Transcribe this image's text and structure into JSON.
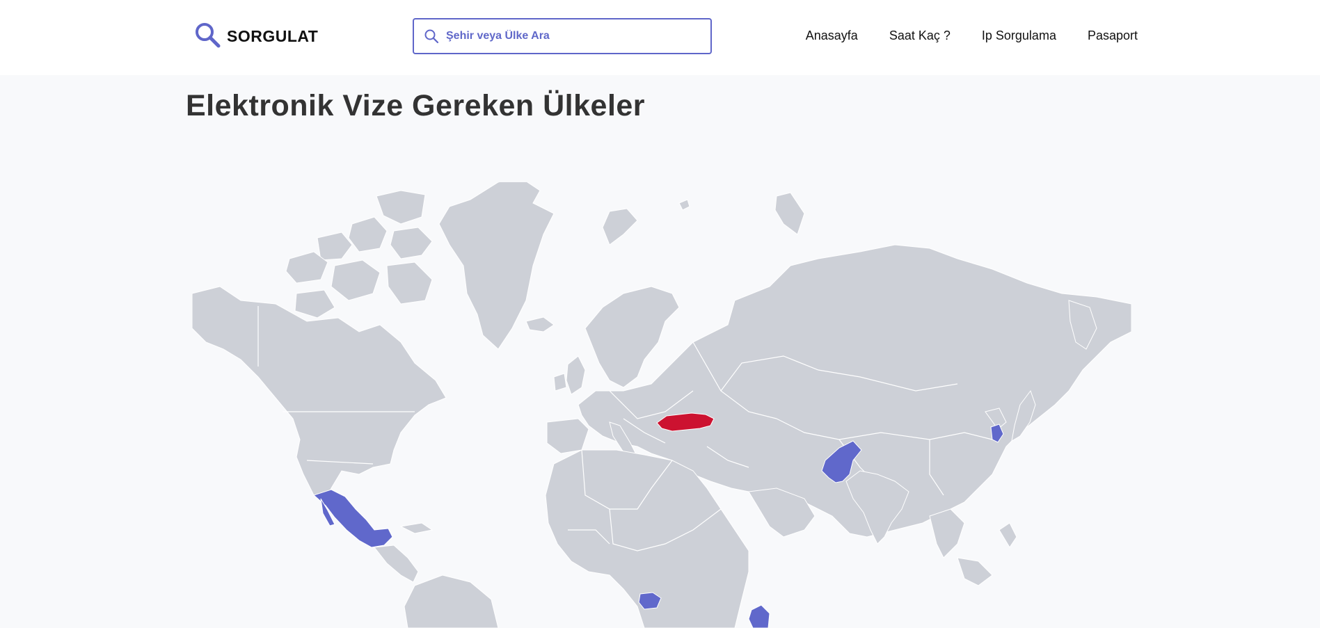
{
  "header": {
    "logo_text": "SORGULAT",
    "search": {
      "placeholder": "Şehir veya Ülke Ara"
    },
    "nav": [
      "Anasayfa",
      "Saat Kaç ?",
      "Ip Sorgulama",
      "Pasaport"
    ]
  },
  "main": {
    "title": "Elektronik Vize Gereken Ülkeler"
  },
  "map": {
    "land_color": "#cdd0d7",
    "evisa_color": "#6068cb",
    "home_color": "#cc1230",
    "home_country": "turkey",
    "evisa_countries": [
      "mexico",
      "pakistan",
      "south-korea",
      "ivory-coast",
      "kenya"
    ]
  },
  "colors": {
    "accent": "#5f66c9",
    "background": "#f8f9fb"
  }
}
